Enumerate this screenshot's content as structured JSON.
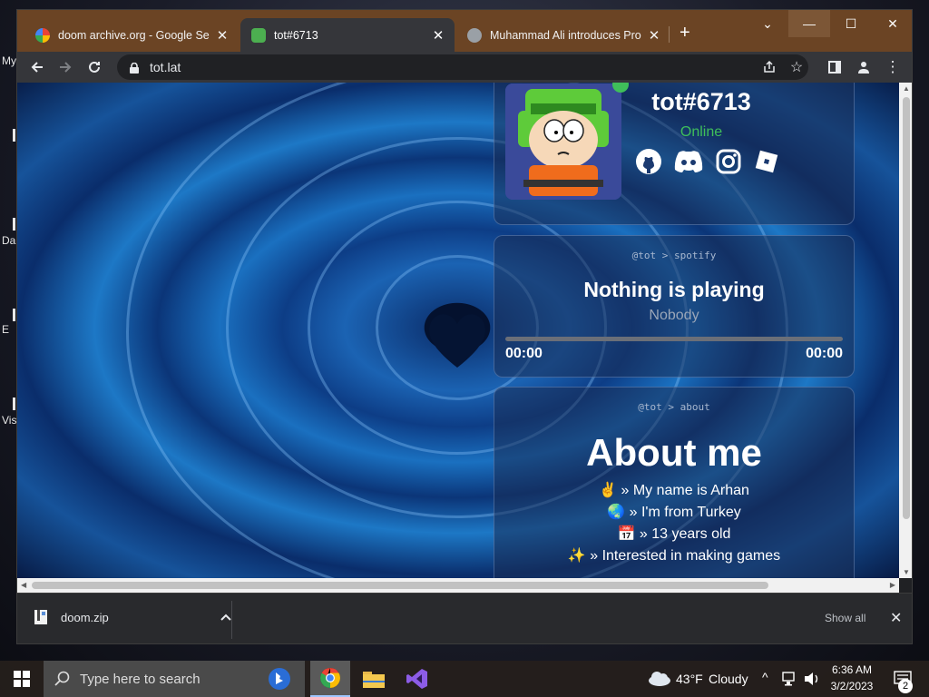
{
  "desktop": {
    "labels": [
      "My",
      "Da",
      "E",
      "Vis"
    ]
  },
  "tabs": [
    {
      "title": "doom archive.org - Google Searc",
      "active": false
    },
    {
      "title": "tot#6713",
      "active": true
    },
    {
      "title": "Muhammad Ali introduces Propl",
      "active": false
    }
  ],
  "window_controls": {
    "dropdown": "⌄",
    "minimize": "—",
    "maximize": "☐",
    "close": "✕"
  },
  "toolbar": {
    "url": "tot.lat"
  },
  "profile": {
    "username": "tot#6713",
    "status": "Online",
    "status_color": "#3fbf5a",
    "socials": [
      "github-icon",
      "discord-icon",
      "instagram-icon",
      "roblox-icon"
    ]
  },
  "spotify": {
    "breadcrumb": "@tot > spotify",
    "track": "Nothing is playing",
    "artist": "Nobody",
    "elapsed": "00:00",
    "duration": "00:00",
    "progress": 0
  },
  "about": {
    "breadcrumb": "@tot > about",
    "title": "About me",
    "lines": [
      {
        "emoji": "✌",
        "text": "» My name is Arhan"
      },
      {
        "emoji": "🌏",
        "text": "» I'm from Turkey"
      },
      {
        "emoji": "📅",
        "text": "» 13 years old"
      },
      {
        "emoji": "✨",
        "text": "» Interested in making games"
      }
    ]
  },
  "downloads": {
    "file": "doom.zip",
    "show_all": "Show all"
  },
  "taskbar": {
    "search_placeholder": "Type here to search",
    "weather_temp": "43°F",
    "weather_text": "Cloudy",
    "time": "6:36 AM",
    "date": "3/2/2023",
    "notifications": "2"
  }
}
